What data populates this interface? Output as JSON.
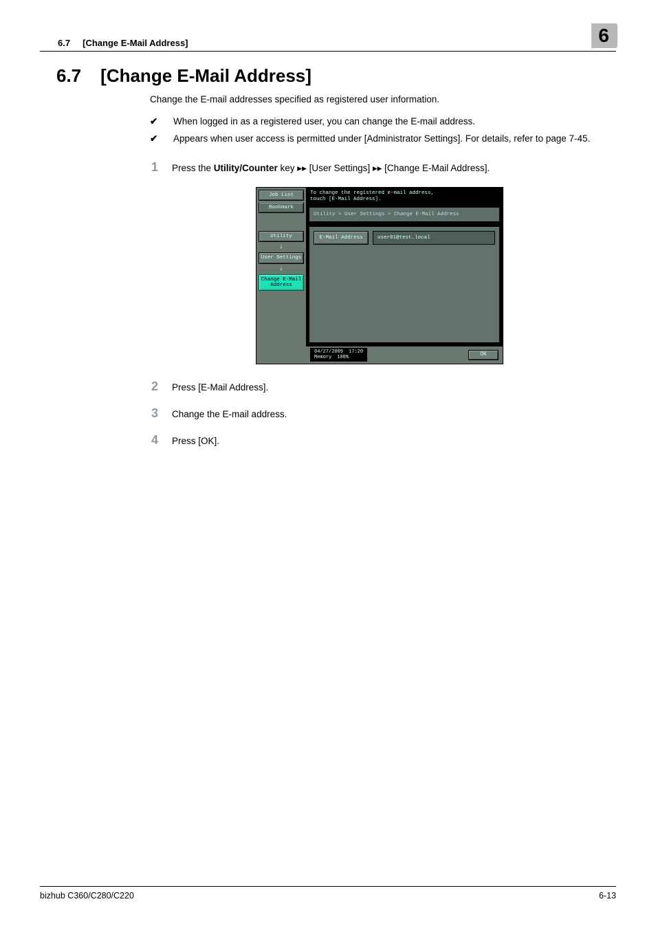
{
  "runhead": {
    "section_ref": "6.7",
    "section_name": "[Change E-Mail Address]",
    "chapter_badge": "6"
  },
  "section": {
    "number": "6.7",
    "title": "[Change E-Mail Address]"
  },
  "intro": "Change the E-mail addresses specified as registered user information.",
  "checks": [
    "When logged in as a registered user, you can change the E-mail address.",
    "Appears when user access is permitted under [Administrator Settings]. For details, refer to page 7-45."
  ],
  "steps": {
    "s1_a": "Press the ",
    "s1_bold": "Utility/Counter",
    "s1_b": " key ▸▸ [User Settings] ▸▸ [Change E-Mail Address].",
    "s2": "Press [E-Mail Address].",
    "s3": "Change the E-mail address.",
    "s4": "Press [OK]."
  },
  "step_nums": {
    "n1": "1",
    "n2": "2",
    "n3": "3",
    "n4": "4"
  },
  "shot": {
    "job_list": "Job List",
    "bookmark": "Bookmark",
    "utility": "Utility",
    "user_settings": "User Settings",
    "change_email": "Change E-Mail\nAddress",
    "instruction": "To change the registered e-mail address,\ntouch [E-Mail Address].",
    "breadcrumb": "Utility > User Settings > Change E-Mail Address",
    "field_label": "E-Mail Address",
    "field_value": "user01@test.local",
    "date": "04/27/2009",
    "time": "17:20",
    "memory_label": "Memory",
    "memory_value": "100%",
    "ok": "OK"
  },
  "footer": {
    "model": "bizhub C360/C280/C220",
    "page": "6-13"
  },
  "glyphs": {
    "check": "✔",
    "arrow_down": "↓"
  }
}
